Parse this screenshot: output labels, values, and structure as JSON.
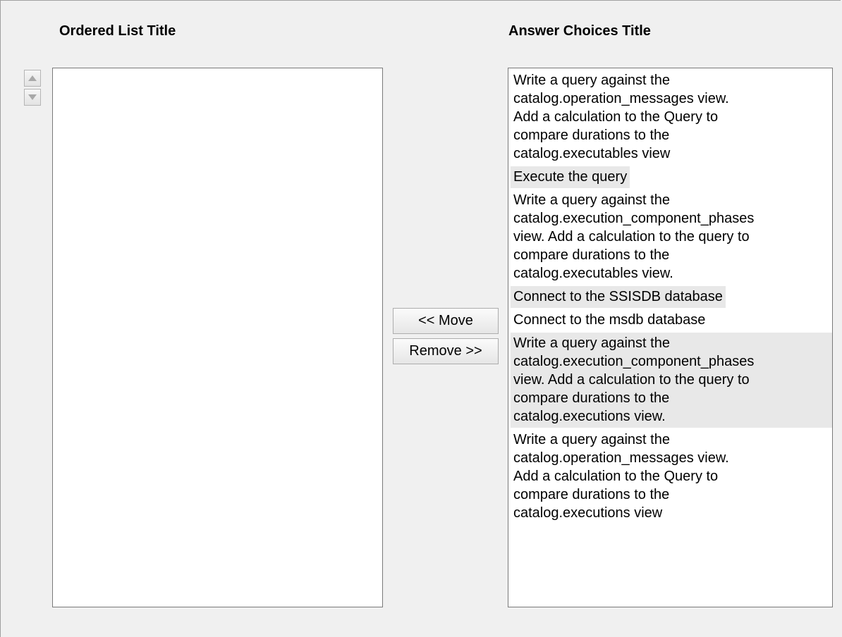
{
  "ordered_list": {
    "title": "Ordered List Title",
    "items": []
  },
  "answer_choices": {
    "title": "Answer Choices Title",
    "items": [
      {
        "text": "Write a query against the\ncatalog.operation_messages view.\nAdd a calculation to the Query to\ncompare durations to the\ncatalog.executables view",
        "shaded": false
      },
      {
        "text": "Execute the query",
        "shaded": true
      },
      {
        "text": "Write a query against the\ncatalog.execution_component_phases\nview. Add a calculation to the query to\ncompare durations to the\ncatalog.executables view.",
        "shaded": false
      },
      {
        "text": "Connect to the SSISDB database",
        "shaded": true
      },
      {
        "text": "Connect to the msdb database",
        "shaded": false
      },
      {
        "text": "Write a query against the\ncatalog.execution_component_phases\nview. Add a calculation to the query to\ncompare durations to the\ncatalog.executions view.",
        "shaded": true
      },
      {
        "text": "Write a query against the\ncatalog.operation_messages view.\nAdd a calculation to the Query to\ncompare durations to the\ncatalog.executions view",
        "shaded": false
      }
    ]
  },
  "buttons": {
    "move_label": "<< Move",
    "remove_label": "Remove >>"
  },
  "icons": {
    "move_up": "triangle-up-icon",
    "move_down": "triangle-down-icon"
  }
}
